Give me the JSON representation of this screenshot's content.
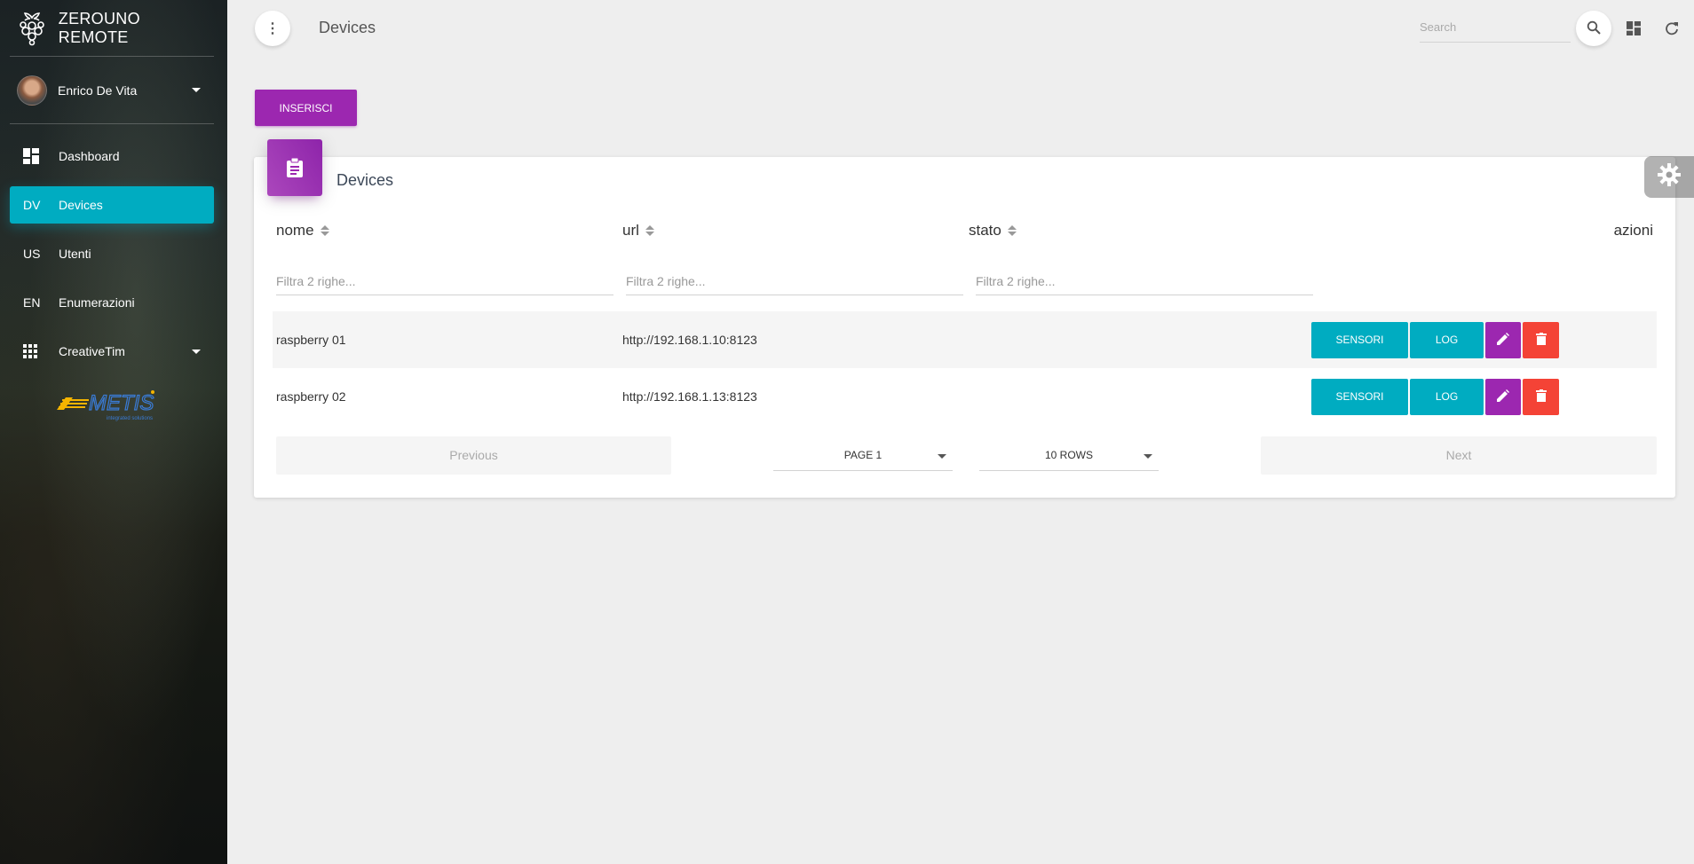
{
  "brand": {
    "name": "ZEROUNO REMOTE",
    "icon": "raspberry-pi-icon"
  },
  "user": {
    "name": "Enrico De Vita"
  },
  "sidebar": {
    "items": [
      {
        "mini": "",
        "label": "Dashboard",
        "icon": "dashboard-icon"
      },
      {
        "mini": "DV",
        "label": "Devices",
        "active": true
      },
      {
        "mini": "US",
        "label": "Utenti"
      },
      {
        "mini": "EN",
        "label": "Enumerazioni"
      },
      {
        "mini": "",
        "label": "CreativeTim",
        "icon": "apps-icon"
      }
    ],
    "logo_text": "METIS",
    "logo_tagline": "integrated solutions"
  },
  "topbar": {
    "title": "Devices",
    "search_placeholder": "Search"
  },
  "toolbar": {
    "insert_label": "INSERISCI"
  },
  "card": {
    "title": "Devices"
  },
  "table": {
    "columns": [
      "nome",
      "url",
      "stato",
      "azioni"
    ],
    "filter_placeholder": "Filtra 2 righe...",
    "rows": [
      {
        "nome": "raspberry 01",
        "url": "http://192.168.1.10:8123",
        "stato": ""
      },
      {
        "nome": "raspberry 02",
        "url": "http://192.168.1.13:8123",
        "stato": ""
      }
    ],
    "actions": {
      "sensori": "SENSORI",
      "log": "LOG"
    }
  },
  "pager": {
    "previous": "Previous",
    "next": "Next",
    "page": "PAGE 1",
    "rows": "10 ROWS"
  },
  "colors": {
    "accent": "#00acc1",
    "primary": "#9c27b0",
    "danger": "#f44336"
  }
}
